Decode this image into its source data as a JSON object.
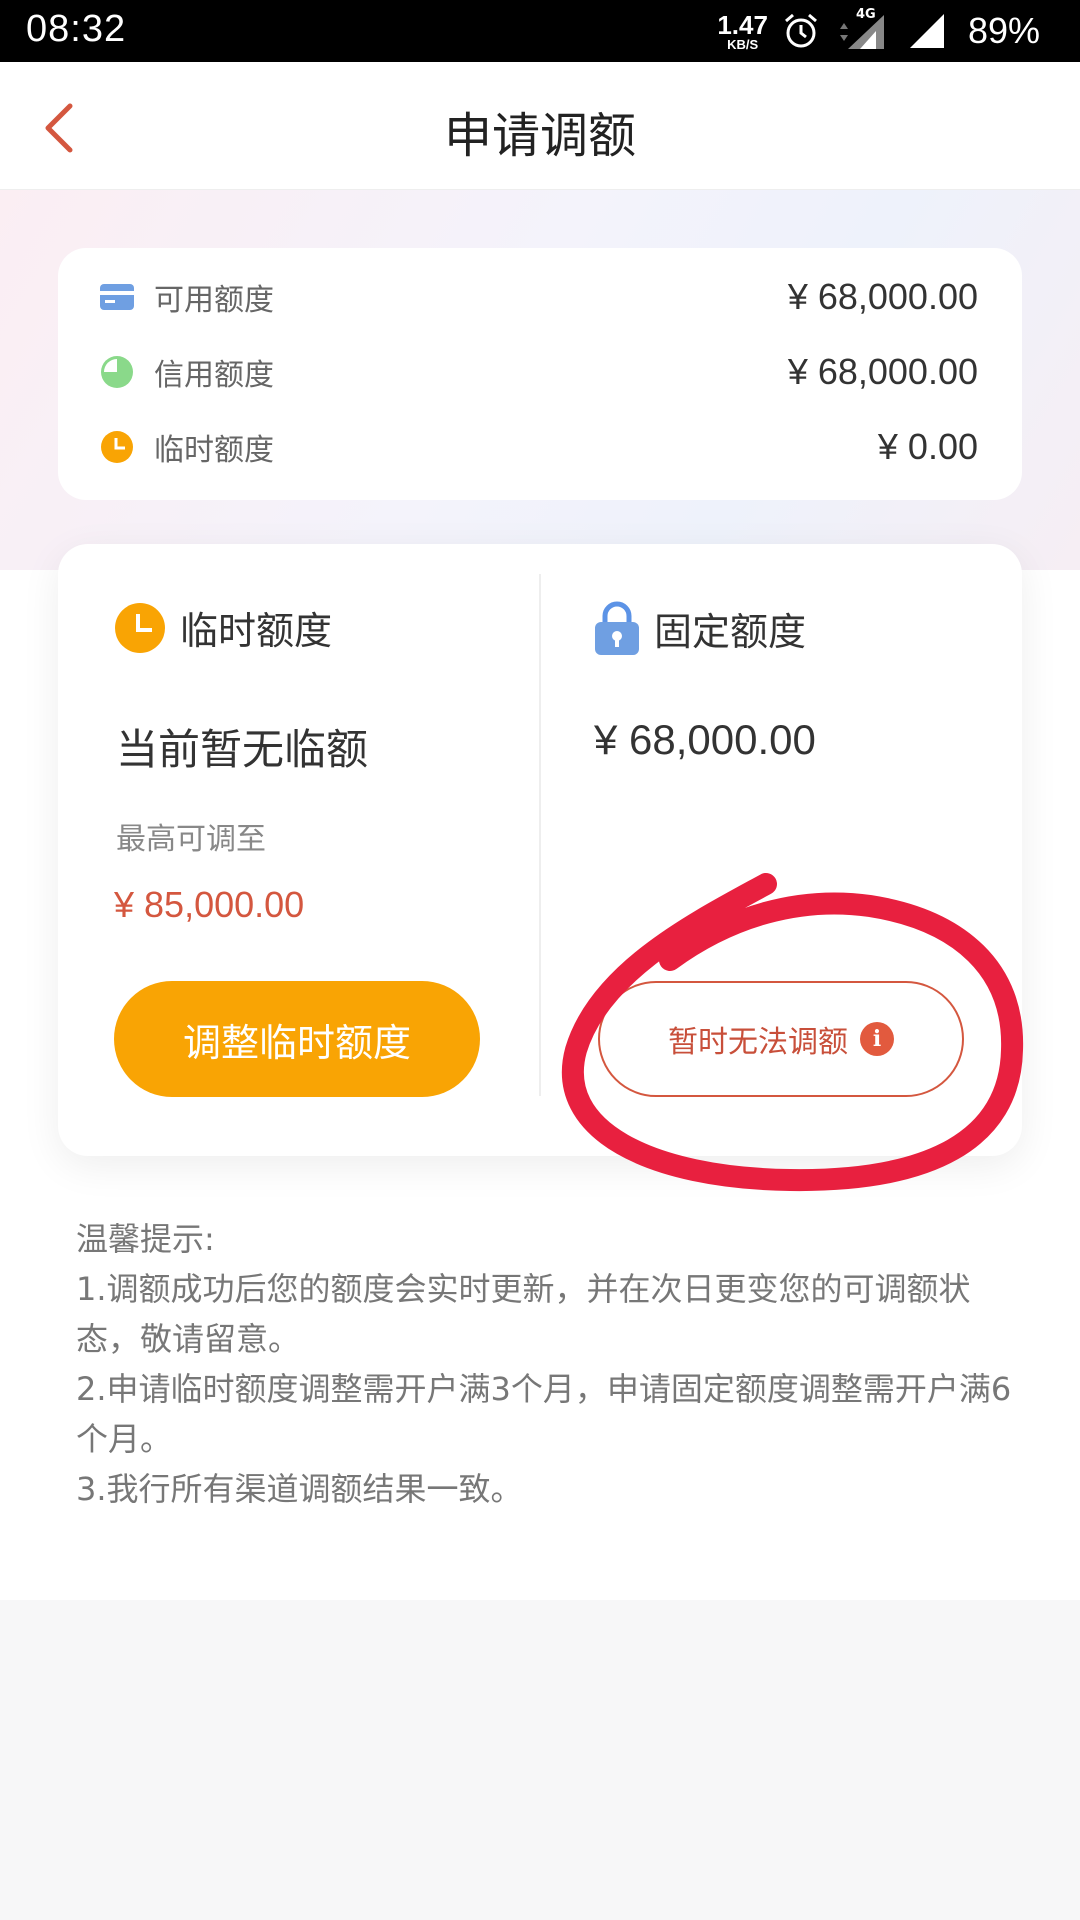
{
  "status_bar": {
    "time": "08:32",
    "speed_value": "1.47",
    "speed_unit": "KB/S",
    "network": "4G",
    "battery": "89%"
  },
  "header": {
    "title": "申请调额"
  },
  "summary": {
    "rows": [
      {
        "label": "可用额度",
        "value": "¥ 68,000.00",
        "icon": "card-icon"
      },
      {
        "label": "信用额度",
        "value": "¥ 68,000.00",
        "icon": "pie-icon"
      },
      {
        "label": "临时额度",
        "value": "¥ 0.00",
        "icon": "clock-icon"
      }
    ]
  },
  "temporary": {
    "heading": "临时额度",
    "current": "当前暂无临额",
    "max_label": "最高可调至",
    "max_value": "¥ 85,000.00",
    "button": "调整临时额度"
  },
  "fixed": {
    "heading": "固定额度",
    "amount": "¥ 68,000.00",
    "button": "暂时无法调额"
  },
  "tips": {
    "title": "温馨提示:",
    "items": [
      "1.调额成功后您的额度会实时更新，并在次日更变您的可调额状态，敬请留意。",
      "2.申请临时额度调整需开户满3个月，申请固定额度调整需开户满6个月。",
      "3.我行所有渠道调额结果一致。"
    ]
  },
  "colors": {
    "accent_orange": "#f9a404",
    "accent_red": "#d4573f",
    "annotation_red": "#e8203f",
    "card_blue": "#6f9fe2",
    "pie_green": "#8ad98a"
  }
}
